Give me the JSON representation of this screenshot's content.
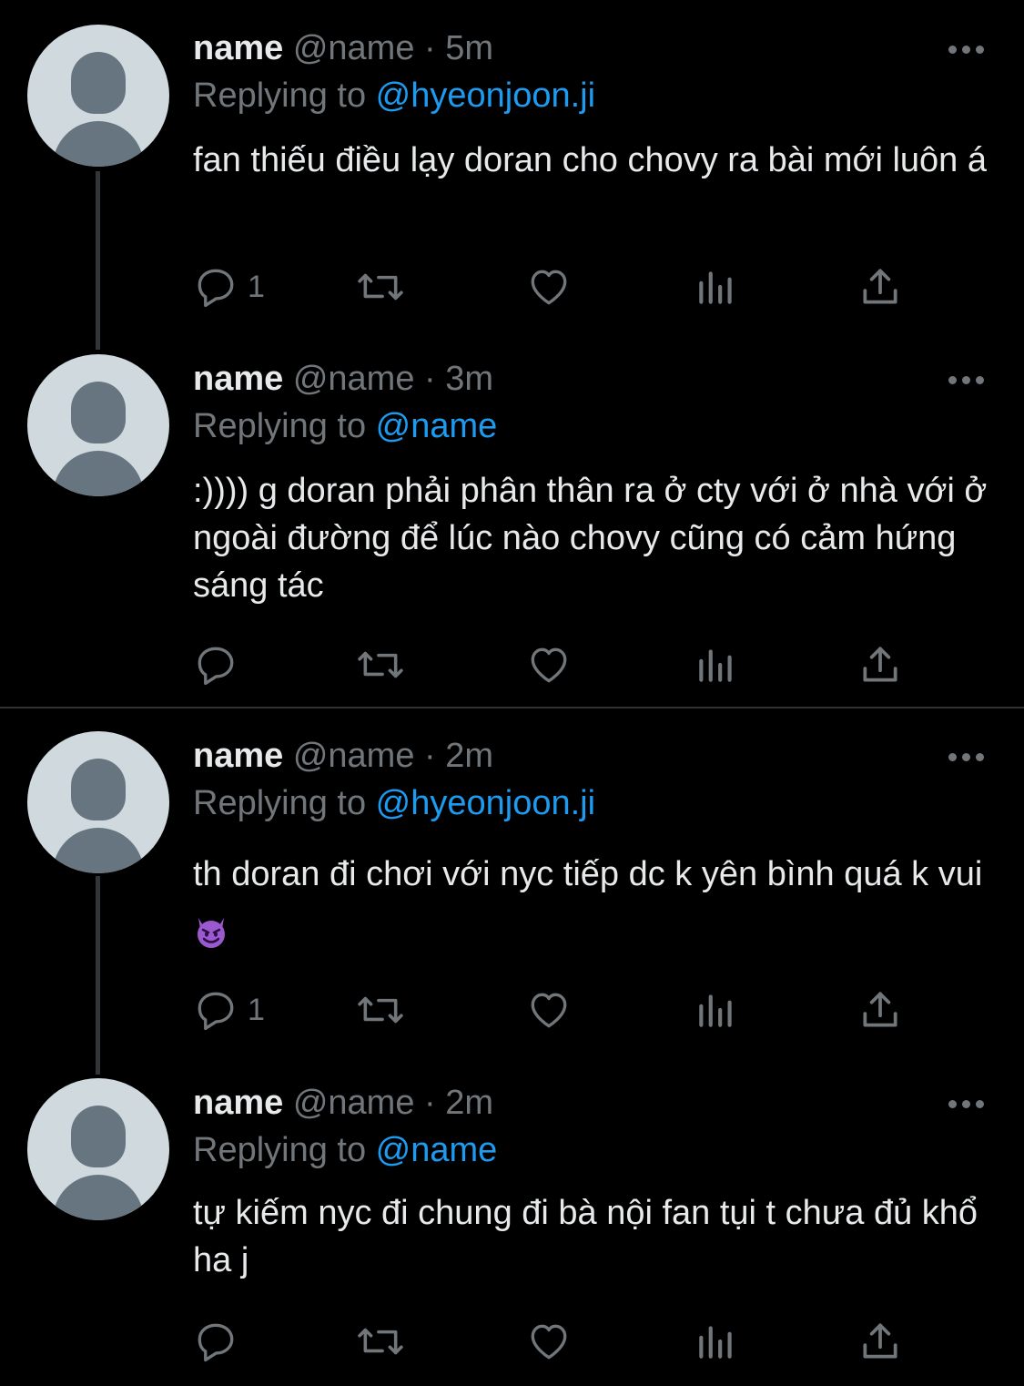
{
  "tweets": [
    {
      "name": "name",
      "handle": "@name",
      "dot": "·",
      "time": "5m",
      "replying_prefix": "Replying to ",
      "replying_to": "@hyeonjoon.ji",
      "text": "fan thiếu điều lạy doran cho chovy ra bài mới luôn á",
      "reply_count": "1"
    },
    {
      "name": "name",
      "handle": "@name",
      "dot": "·",
      "time": "3m",
      "replying_prefix": "Replying to ",
      "replying_to": "@name",
      "text": ":)))) g doran phải phân thân ra ở cty với ở nhà với ở ngoài đường để lúc nào chovy cũng có cảm hứng sáng tác",
      "reply_count": ""
    },
    {
      "name": "name",
      "handle": "@name",
      "dot": "·",
      "time": "2m",
      "replying_prefix": "Replying to ",
      "replying_to": "@hyeonjoon.ji",
      "text": "th doran đi chơi với nyc tiếp dc k yên bình quá k vui",
      "emoji": "smiling-imp-emoji",
      "reply_count": "1"
    },
    {
      "name": "name",
      "handle": "@name",
      "dot": "·",
      "time": "2m",
      "replying_prefix": "Replying to ",
      "replying_to": "@name",
      "text": "tự kiếm nyc đi chung đi bà nội fan tụi t chưa đủ khổ ha j",
      "reply_count": ""
    }
  ],
  "icons": {
    "reply": "speech-bubble-icon",
    "retweet": "retweet-icon",
    "like": "heart-icon",
    "views": "bar-chart-icon",
    "share": "share-upload-icon",
    "more": "more-dots-icon"
  },
  "colors": {
    "background": "#000000",
    "text": "#e7e9ea",
    "muted": "#71767b",
    "mention": "#1d9bf0",
    "avatar_bg": "#cfd9de",
    "avatar_fg": "#66757f"
  }
}
